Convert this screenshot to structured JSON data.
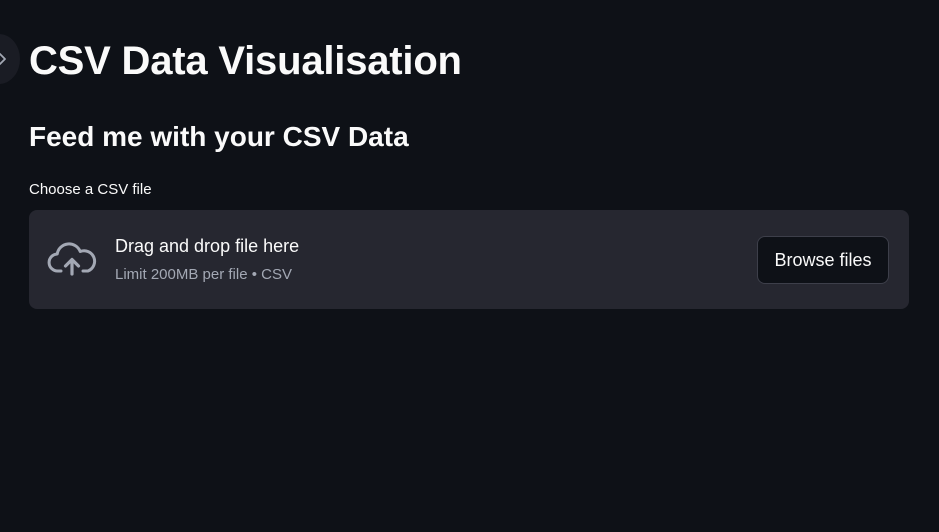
{
  "header": {
    "title": "CSV Data Visualisation",
    "subheader": "Feed me with your CSV Data"
  },
  "uploader": {
    "label": "Choose a CSV file",
    "dropzone_text": "Drag and drop file here",
    "limit_text": "Limit 200MB per file • CSV",
    "browse_label": "Browse files",
    "icon": "cloud-upload-icon"
  },
  "sidebar": {
    "toggle_icon": "chevron-right-icon"
  },
  "colors": {
    "background": "#0e1117",
    "dropzone_background": "#262730",
    "text": "#fafafa",
    "muted_text": "#a3a8b4"
  }
}
